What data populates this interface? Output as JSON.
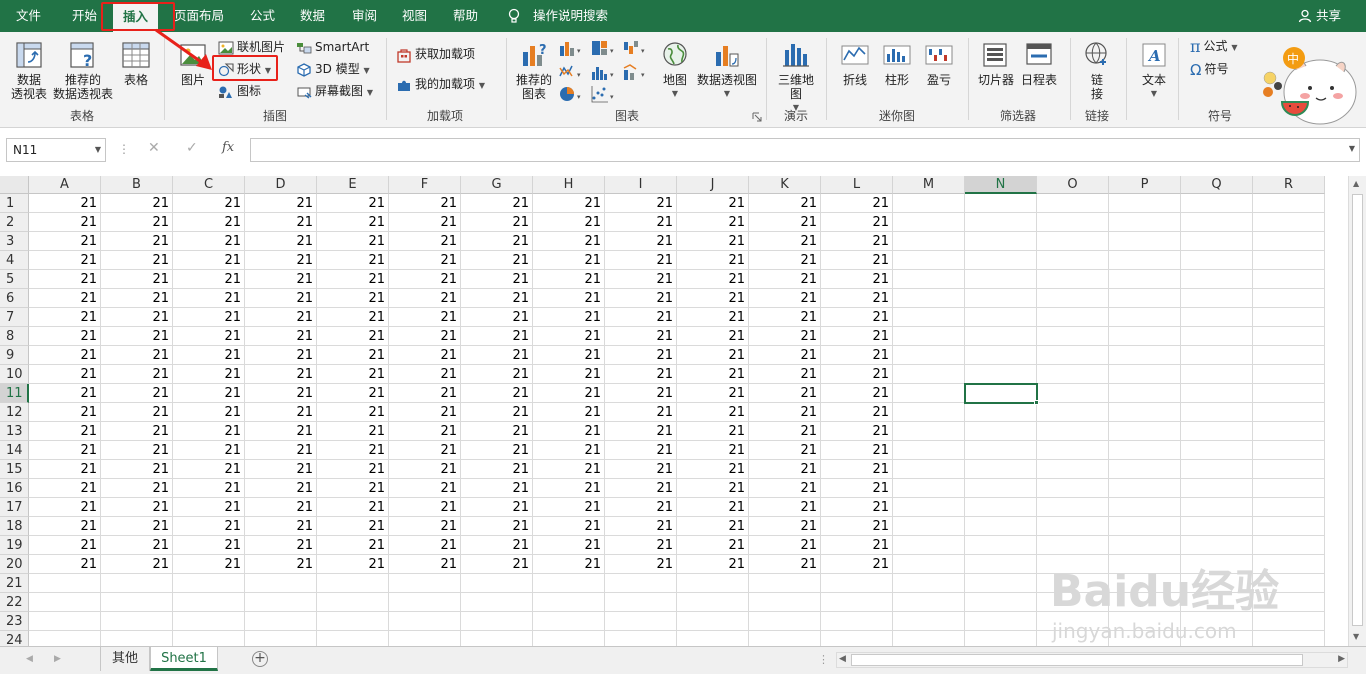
{
  "ribbon_tabs": [
    "文件",
    "开始",
    "插入",
    "页面布局",
    "公式",
    "数据",
    "审阅",
    "视图",
    "帮助",
    "操作说明搜索"
  ],
  "share_label": "共享",
  "groups": {
    "tables": {
      "label": "表格",
      "pivot_table": "数据\n透视表",
      "recommended_pivot": "推荐的\n数据透视表",
      "table": "表格"
    },
    "illustrations": {
      "label": "插图",
      "picture": "图片",
      "online_picture": "联机图片",
      "shapes": "形状",
      "icons": "图标",
      "smartart": "SmartArt",
      "model_3d": "3D 模型",
      "screenshot": "屏幕截图"
    },
    "addins": {
      "label": "加载项",
      "get_addins": "获取加载项",
      "my_addins": "我的加载项"
    },
    "charts": {
      "label": "图表",
      "recommended_charts": "推荐的\n图表",
      "maps": "地图",
      "pivot_chart": "数据透视图"
    },
    "tours": {
      "label": "演示",
      "map_3d": "三维地\n图"
    },
    "sparklines": {
      "label": "迷你图",
      "line": "折线",
      "column": "柱形",
      "win_loss": "盈亏"
    },
    "filters": {
      "label": "筛选器",
      "slicer": "切片器",
      "timeline": "日程表"
    },
    "links": {
      "label": "链接",
      "link": "链\n接"
    },
    "text": {
      "label": "",
      "text": "文本"
    },
    "symbols": {
      "label": "符号",
      "equation": "公式",
      "symbol": "符号"
    }
  },
  "formula_bar": {
    "name_box": "N11",
    "fx": "fx",
    "formula": ""
  },
  "columns": [
    "A",
    "B",
    "C",
    "D",
    "E",
    "F",
    "G",
    "H",
    "I",
    "J",
    "K",
    "L",
    "M",
    "N",
    "O",
    "P",
    "Q",
    "R"
  ],
  "rows": [
    "1",
    "2",
    "3",
    "4",
    "5",
    "6",
    "7",
    "8",
    "9",
    "10",
    "11",
    "12",
    "13",
    "14",
    "15",
    "16",
    "17",
    "18",
    "19",
    "20",
    "21",
    "22",
    "23",
    "24"
  ],
  "cell_value": "21",
  "filled_rows": 20,
  "filled_cols": 12,
  "selected_cell": {
    "col": "N",
    "row": "11"
  },
  "sheet_tabs": [
    "其他",
    "Sheet1"
  ],
  "active_sheet": "Sheet1",
  "watermark": {
    "brand": "Baidu经验",
    "url": "jingyan.baidu.com"
  },
  "colors": {
    "accent": "#217346",
    "highlight": "#e8211a"
  }
}
